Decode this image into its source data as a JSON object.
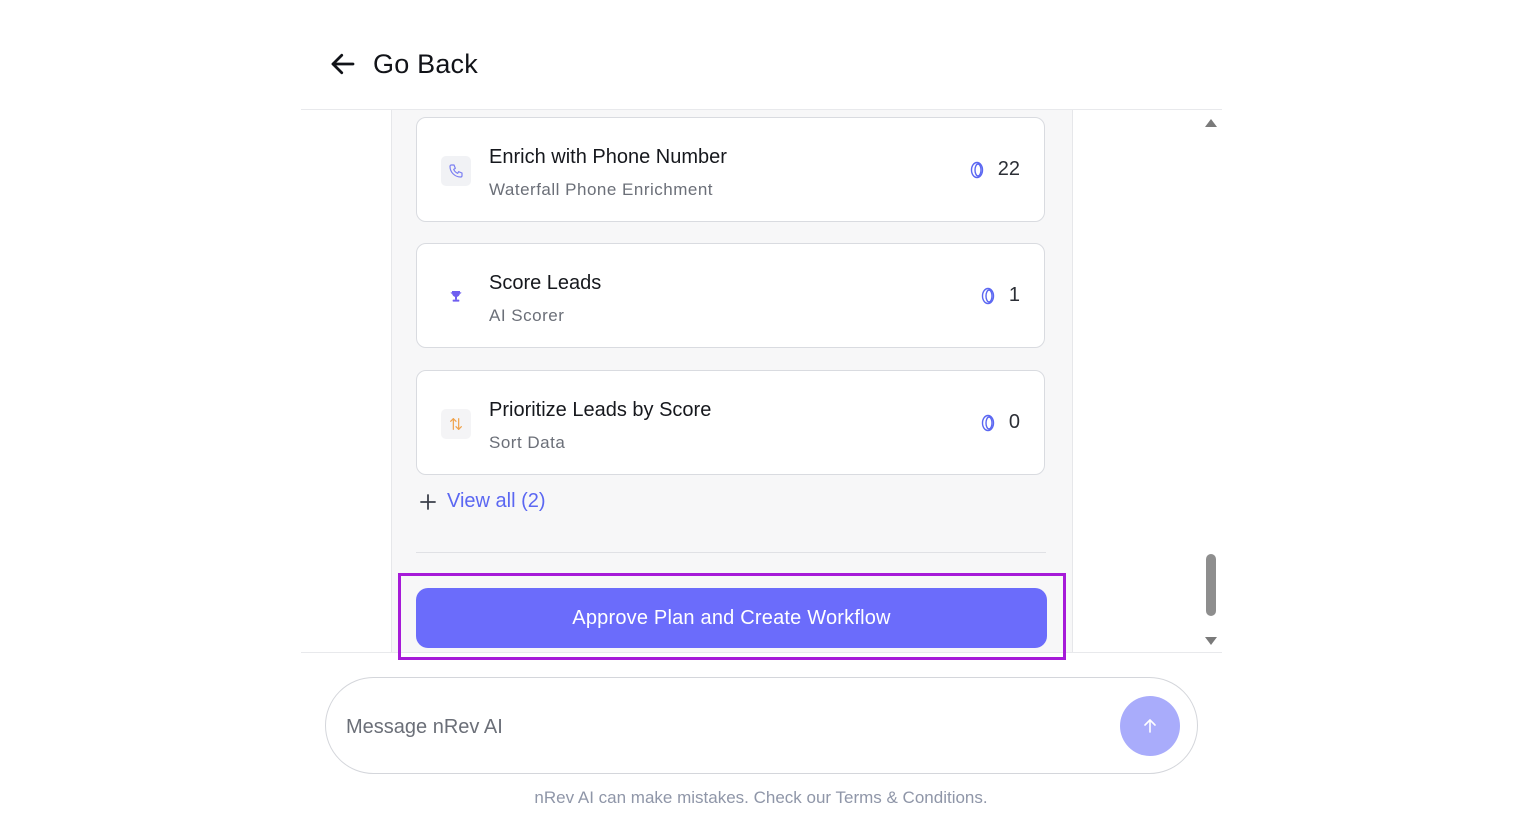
{
  "header": {
    "back_label": "Go Back",
    "back_icon": "arrow-left-icon"
  },
  "steps": [
    {
      "title": "Enrich with Phone Number",
      "subtitle": "Waterfall Phone Enrichment",
      "credits": "22",
      "icon": "phone-icon",
      "icon_color": "#7b7ff2",
      "icon_bg": "#f1f2f5"
    },
    {
      "title": "Score Leads",
      "subtitle": "AI Scorer",
      "credits": "1",
      "icon": "trophy-icon",
      "icon_color": "#6f5ef0",
      "icon_bg": "#ffffff"
    },
    {
      "title": "Prioritize Leads by Score",
      "subtitle": "Sort Data",
      "credits": "0",
      "icon": "sort-arrows-icon",
      "icon_color": "#f0a24a",
      "icon_bg": "#f4f4f6"
    }
  ],
  "view_all_label": "View all (2)",
  "approve_label": "Approve Plan and Create Workflow",
  "composer": {
    "placeholder": "Message nRev AI",
    "value": "",
    "send_icon": "arrow-up-icon"
  },
  "disclaimer": "nRev AI can make mistakes. Check our Terms & Conditions.",
  "colors": {
    "accent": "#6b6cfb",
    "link": "#5b67f2",
    "highlight": "#a61ad8",
    "send_disabled": "#a9acfb"
  }
}
